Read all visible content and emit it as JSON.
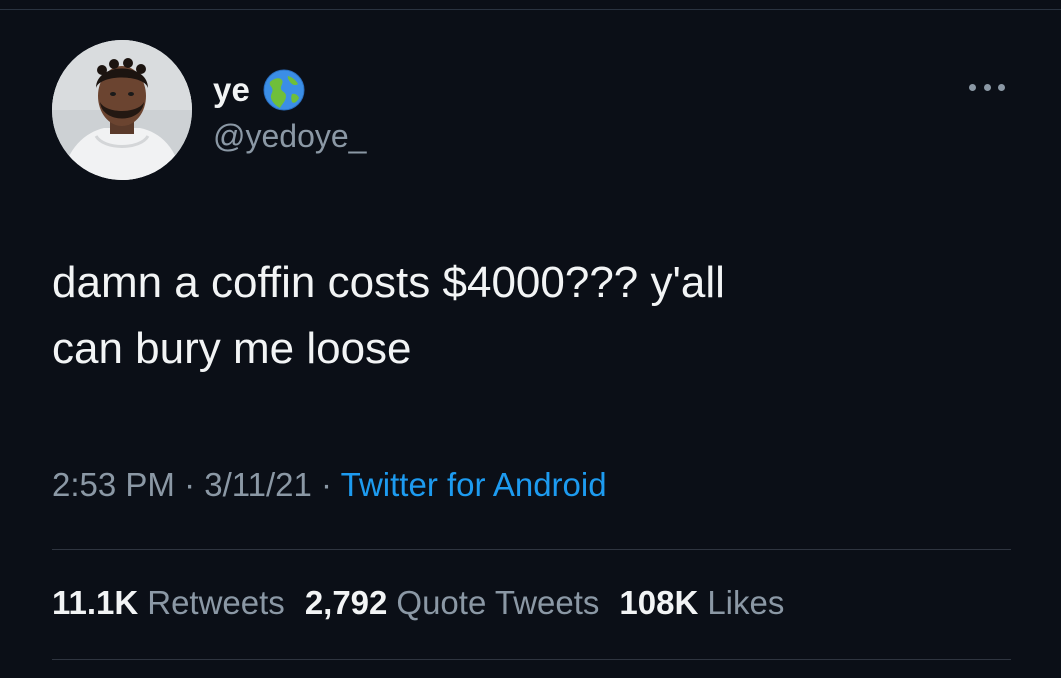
{
  "author": {
    "display_name": "ye",
    "handle": "@yedoye_",
    "badge_icon": "globe-americas-icon"
  },
  "tweet": {
    "text": "damn a coffin costs $4000??? y'all\ncan bury me loose",
    "time": "2:53 PM",
    "separator_1": " · ",
    "date": "3/11/21",
    "separator_2": " · ",
    "source": "Twitter for Android"
  },
  "stats": {
    "retweets_count": "11.1K",
    "retweets_label": "Retweets",
    "quotes_count": "2,792",
    "quotes_label": "Quote Tweets",
    "likes_count": "108K",
    "likes_label": "Likes"
  },
  "colors": {
    "background": "#0b0f17",
    "link": "#1d9bf0",
    "muted": "#8b98a5",
    "text": "#f2f4f5"
  }
}
